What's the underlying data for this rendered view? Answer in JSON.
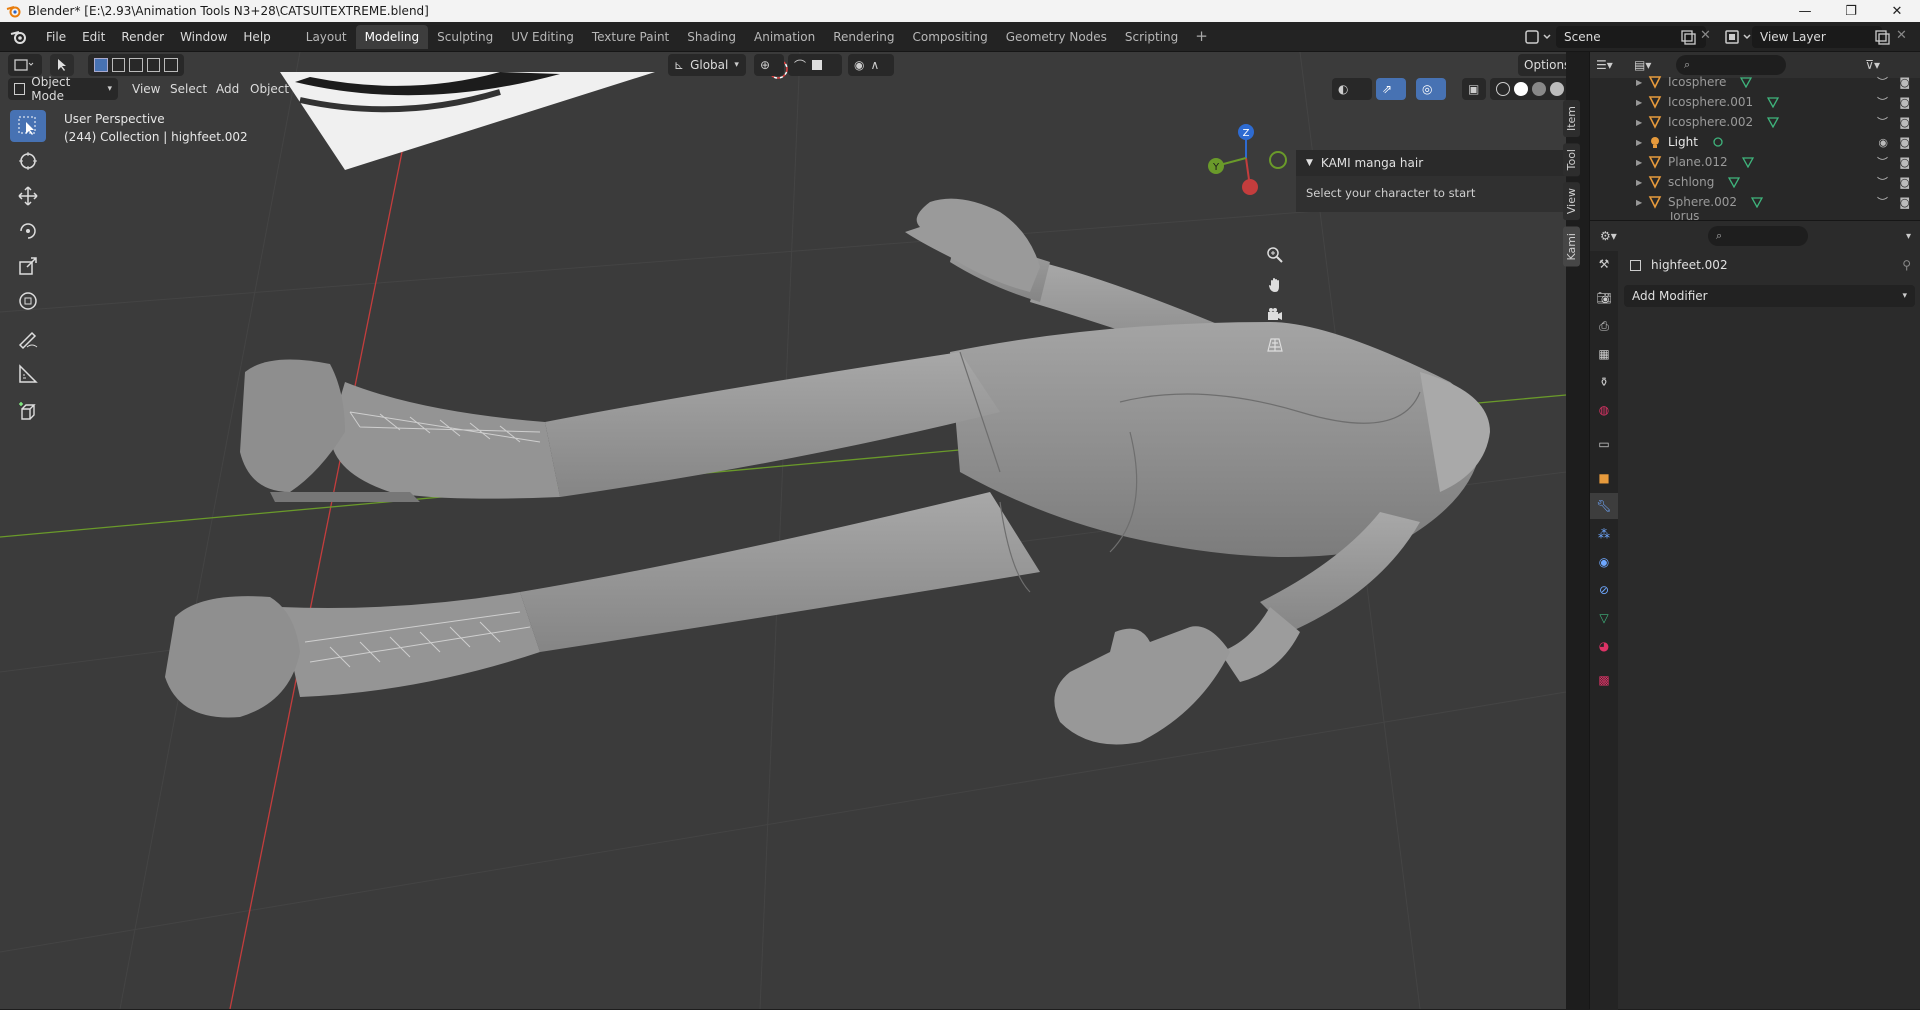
{
  "window": {
    "title": "Blender* [E:\\2.93\\Animation Tools N3+28\\CATSUITEXTREME.blend]",
    "controls": [
      "—",
      "❐",
      "✕"
    ]
  },
  "menu": [
    "File",
    "Edit",
    "Render",
    "Window",
    "Help"
  ],
  "workspaces": [
    {
      "label": "Layout",
      "active": false
    },
    {
      "label": "Modeling",
      "active": true
    },
    {
      "label": "Sculpting",
      "active": false
    },
    {
      "label": "UV Editing",
      "active": false
    },
    {
      "label": "Texture Paint",
      "active": false
    },
    {
      "label": "Shading",
      "active": false
    },
    {
      "label": "Animation",
      "active": false
    },
    {
      "label": "Rendering",
      "active": false
    },
    {
      "label": "Compositing",
      "active": false
    },
    {
      "label": "Geometry Nodes",
      "active": false
    },
    {
      "label": "Scripting",
      "active": false
    }
  ],
  "workspace_add": "+",
  "scene": {
    "name": "Scene"
  },
  "view_layer": {
    "name": "View Layer"
  },
  "viewport": {
    "mode": "Object Mode",
    "menus": [
      "View",
      "Select",
      "Add",
      "Object"
    ],
    "transform_orientation": "Global",
    "options_label": "Options",
    "perspective": "User Perspective",
    "collection_info": "(244) Collection | highfeet.002",
    "gizmo": {
      "x": "X",
      "y": "Y",
      "z": "Z"
    }
  },
  "npanel": {
    "title": "KAMI manga hair",
    "body": "Select your character to start",
    "tabs": [
      "Item",
      "Tool",
      "View",
      "Kami"
    ]
  },
  "outliner": {
    "rows": [
      {
        "name": "Icosphere",
        "dim": true
      },
      {
        "name": "Icosphere.001",
        "dim": true
      },
      {
        "name": "Icosphere.002",
        "dim": true
      },
      {
        "name": "Light",
        "dim": false
      },
      {
        "name": "Plane.012",
        "dim": true
      },
      {
        "name": "schlong",
        "dim": true
      },
      {
        "name": "Sphere.002",
        "dim": true
      },
      {
        "name": "Torus",
        "dim": true
      }
    ]
  },
  "properties": {
    "object_name": "highfeet.002",
    "add_modifier": "Add Modifier"
  },
  "colors": {
    "accent": "#4772b3",
    "viewport_bg": "#3b3b3b",
    "axis_x": "#c43d3d",
    "axis_y": "#6a9a2a",
    "axis_z": "#2e6bd1"
  }
}
